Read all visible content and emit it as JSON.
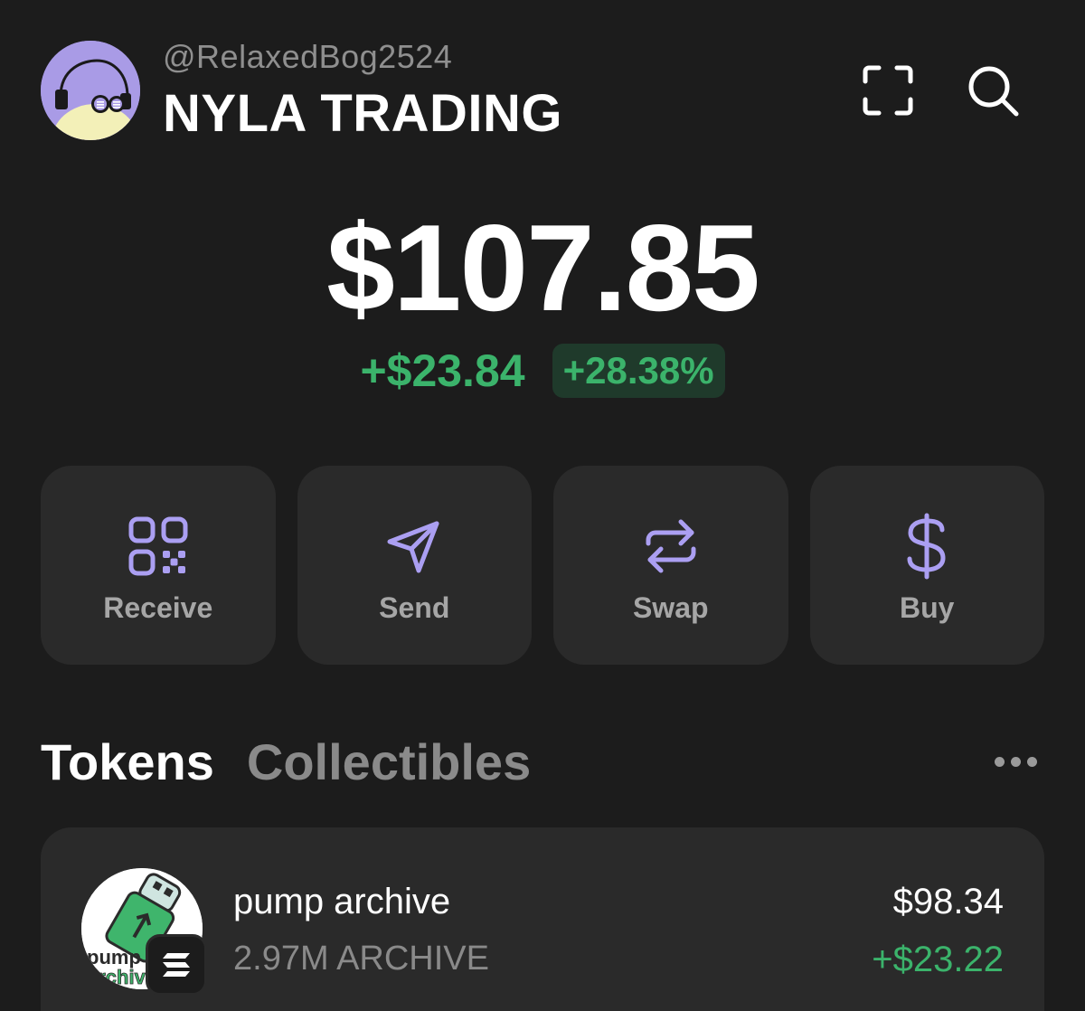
{
  "header": {
    "username": "@RelaxedBog2524",
    "account_name": "NYLA TRADING"
  },
  "icons": {
    "scan": "scan-icon",
    "search": "search-icon",
    "more": "more-icon"
  },
  "balance": {
    "total": "$107.85",
    "change_amount": "+$23.84",
    "change_percent": "+28.38%"
  },
  "actions": [
    {
      "label": "Receive",
      "icon": "qr-code-icon"
    },
    {
      "label": "Send",
      "icon": "send-icon"
    },
    {
      "label": "Swap",
      "icon": "swap-icon"
    },
    {
      "label": "Buy",
      "icon": "dollar-icon"
    }
  ],
  "tabs": {
    "tokens": "Tokens",
    "collectibles": "Collectibles"
  },
  "tokens": [
    {
      "name": "pump archive",
      "amount": "2.97M ARCHIVE",
      "value": "$98.34",
      "change": "+$23.22",
      "logo_text": "pump archive"
    }
  ],
  "colors": {
    "background": "#1c1c1c",
    "card": "#2a2a2a",
    "accent": "#ab9ff2",
    "positive": "#3bb36b"
  }
}
